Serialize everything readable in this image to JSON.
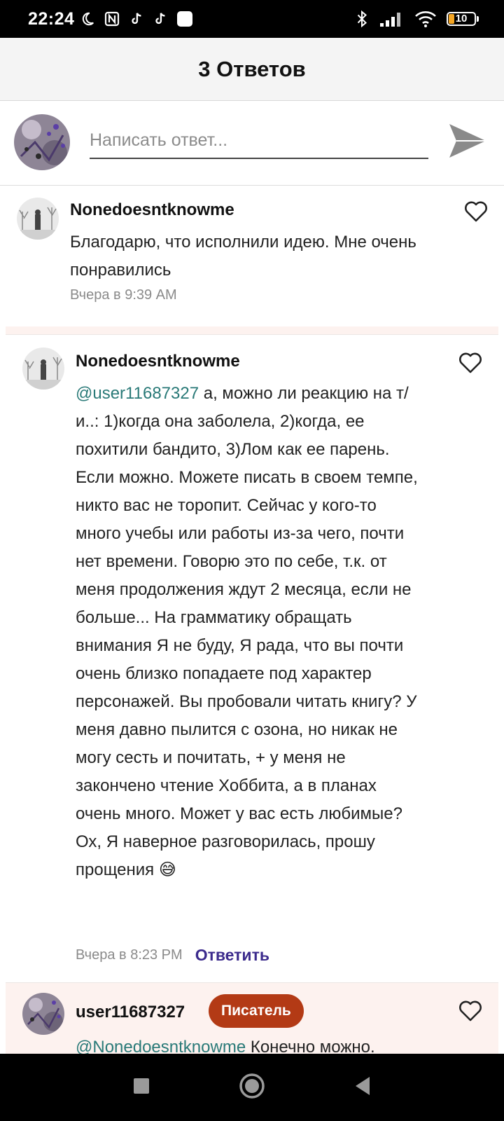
{
  "status_bar": {
    "time": "22:24",
    "battery": "10",
    "icons": [
      "moon-icon",
      "nfc-icon",
      "tiktok-icon",
      "tiktok-icon",
      "app-icon",
      "bluetooth-icon",
      "signal-icon",
      "wifi-icon",
      "battery-icon"
    ]
  },
  "header": {
    "title": "3 Ответов"
  },
  "reply_bar": {
    "placeholder": "Написать ответ...",
    "value": ""
  },
  "comments": [
    {
      "username": "Nonedoesntknowme",
      "text": "Благодарю, что исполнили идею. Мне очень понравились",
      "timestamp": "Вчера в 9:39 AM"
    },
    {
      "username": "Nonedoesntknowme",
      "mention": "@user11687327",
      "text": " а, можно ли реакцию на т/и..: 1)когда она заболела, 2)когда, ее похитили бандито, 3)Лом как ее парень. Если можно. Можете писать в своем темпе, никто вас не торопит. Сейчас у кого-то много учебы или работы из-за чего, почти нет времени. Говорю это по себе, т.к. от меня продолжения ждут 2 месяца, если не больше... На грамматику обращать внимания Я не буду, Я рада, что вы почти очень близко попадаете под характер персонажей. Вы пробовали читать книгу? У меня давно пылится с озона, но никак не могу сесть и почитать, + у меня не закончено чтение Хоббита, а в планах очень много. Может у вас есть любимые? Ох, Я наверное разговорилась, прошу прощения 😅",
      "timestamp": "Вчера в 8:23 PM",
      "reply_label": "Ответить"
    },
    {
      "username": "user11687327",
      "badge": "Писатель",
      "mention": "@Nonedoesntknowme",
      "text": " Конечно можно."
    }
  ],
  "colors": {
    "mention": "#2a7a78",
    "badge": "#b33a15",
    "reply_link": "#3b2a8c",
    "highlight_bg": "#fdf2ef"
  }
}
